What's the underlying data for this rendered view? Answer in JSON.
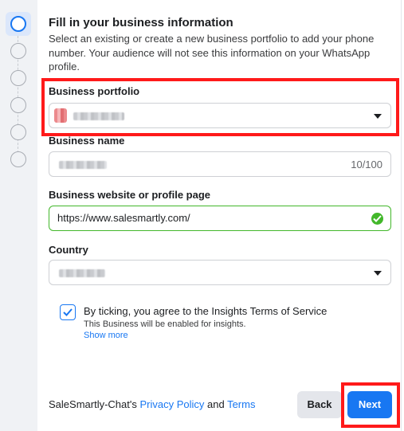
{
  "steps": {
    "count": 6,
    "active_index": 0
  },
  "form": {
    "title": "Fill in your business information",
    "description": "Select an existing or create a new business portfolio to add your phone number. Your audience will not see this information on your WhatsApp profile.",
    "business_portfolio": {
      "label": "Business portfolio"
    },
    "business_name": {
      "label": "Business name",
      "counter": "10/100"
    },
    "website": {
      "label": "Business website or profile page",
      "value": "https://www.salesmartly.com/"
    },
    "country": {
      "label": "Country"
    },
    "terms": {
      "checked": true,
      "text": "By ticking, you agree to the Insights Terms of Service",
      "subtext": "This Business will be enabled for insights.",
      "show_more": "Show more"
    }
  },
  "footer": {
    "prefix": "SaleSmartly-Chat's ",
    "privacy_policy": "Privacy Policy",
    "and": " and ",
    "terms": "Terms",
    "back_label": "Back",
    "next_label": "Next"
  },
  "colors": {
    "accent": "#1877f2",
    "success": "#42b72a",
    "highlight": "#ff1a1a"
  }
}
